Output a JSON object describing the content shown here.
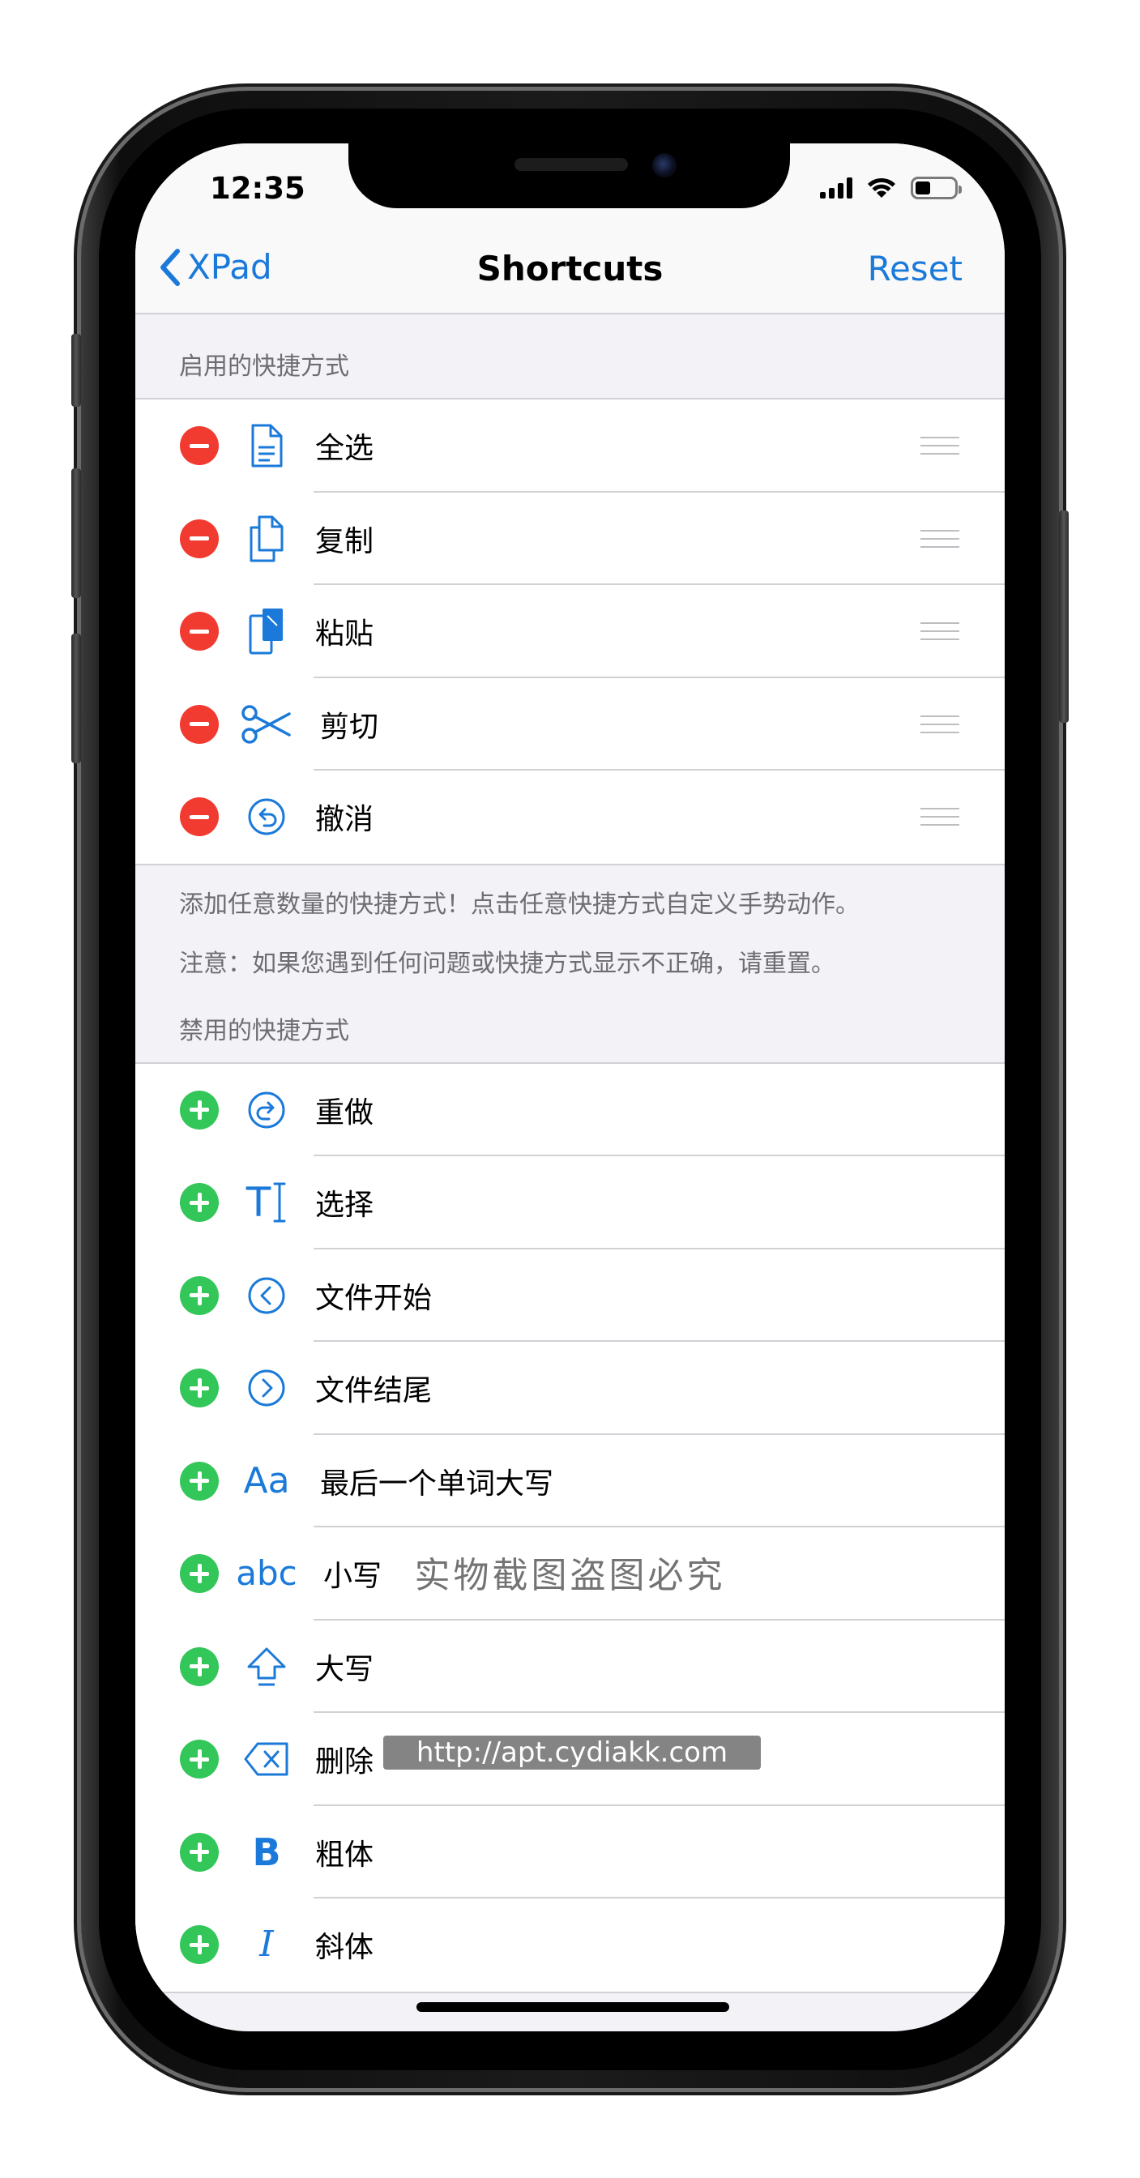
{
  "status_bar": {
    "time": "12:35"
  },
  "nav": {
    "back_label": "XPad",
    "title": "Shortcuts",
    "reset_label": "Reset"
  },
  "enabled_section": {
    "header": "启用的快捷方式",
    "items": [
      {
        "label": "全选",
        "icon": "document-icon"
      },
      {
        "label": "复制",
        "icon": "copy-icon"
      },
      {
        "label": "粘贴",
        "icon": "paste-icon"
      },
      {
        "label": "剪切",
        "icon": "scissors-icon"
      },
      {
        "label": "撤消",
        "icon": "undo-icon"
      }
    ],
    "footer_lines": [
      "添加任意数量的快捷方式！点击任意快捷方式自定义手势动作。",
      "注意：如果您遇到任何问题或快捷方式显示不正确，请重置。"
    ]
  },
  "disabled_section": {
    "header": "禁用的快捷方式",
    "items": [
      {
        "label": "重做",
        "icon": "redo-icon"
      },
      {
        "label": "选择",
        "icon": "text-cursor-icon",
        "glyph": "T"
      },
      {
        "label": "文件开始",
        "icon": "chevron-left-circle-icon"
      },
      {
        "label": "文件结尾",
        "icon": "chevron-right-circle-icon"
      },
      {
        "label": "最后一个单词大写",
        "icon": "capitalize-icon",
        "glyph": "Aa"
      },
      {
        "label": "小写",
        "icon": "lowercase-icon",
        "glyph": "abc"
      },
      {
        "label": "大写",
        "icon": "shift-icon"
      },
      {
        "label": "删除",
        "icon": "delete-backward-icon"
      },
      {
        "label": "粗体",
        "icon": "bold-icon",
        "glyph": "B"
      },
      {
        "label": "斜体",
        "icon": "italic-icon",
        "glyph": "I"
      }
    ]
  },
  "watermark": {
    "text": "实物截图盗图必究",
    "url": "http://apt.cydiakk.com"
  },
  "colors": {
    "accent": "#1b7ad9",
    "remove": "#f23b30",
    "add": "#33c659",
    "grouped_background": "#f2f2f7"
  }
}
